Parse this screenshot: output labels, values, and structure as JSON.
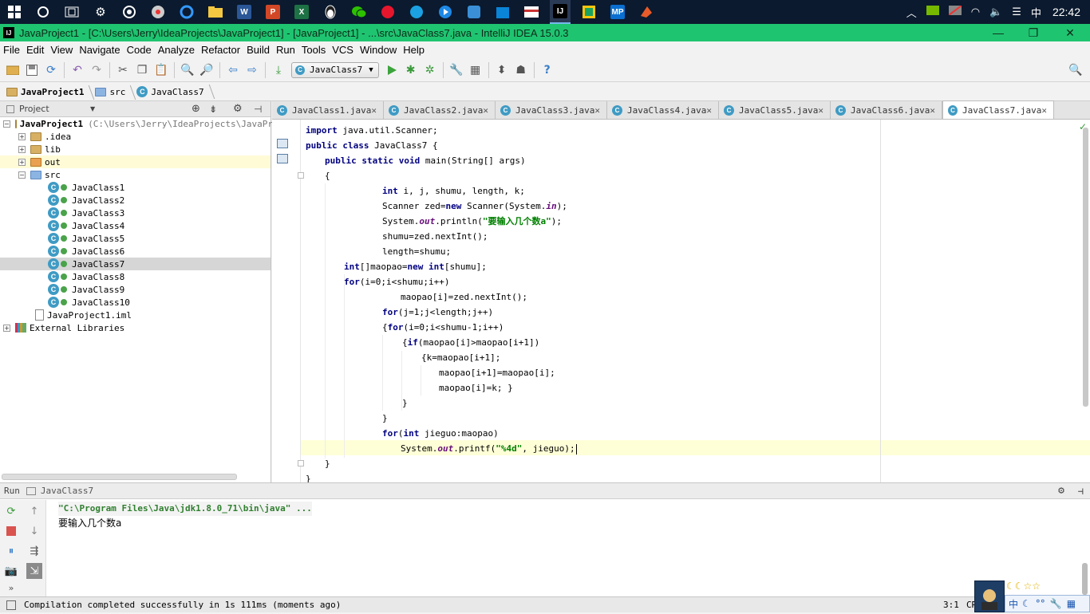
{
  "taskbar": {
    "apps": [
      "word-app",
      "ppt-app",
      "excel-app",
      "intellij-app",
      "mp-app"
    ],
    "word_label": "W",
    "ppt_label": "P",
    "excel_label": "X",
    "intellij_label": "IJ",
    "mp_label": "MP",
    "ime_lang": "中",
    "clock": "22:42"
  },
  "window": {
    "title": "JavaProject1 - [C:\\Users\\Jerry\\IdeaProjects\\JavaProject1] - [JavaProject1] - ...\\src\\JavaClass7.java - IntelliJ IDEA 15.0.3",
    "icon_label": "IJ"
  },
  "menu": [
    "File",
    "Edit",
    "View",
    "Navigate",
    "Code",
    "Analyze",
    "Refactor",
    "Build",
    "Run",
    "Tools",
    "VCS",
    "Window",
    "Help"
  ],
  "toolbar": {
    "run_config": "JavaClass7"
  },
  "breadcrumb": {
    "project": "JavaProject1",
    "src": "src",
    "file": "JavaClass7"
  },
  "project_panel": {
    "title": "Project",
    "root_label": "JavaProject1",
    "root_path": "(C:\\Users\\Jerry\\IdeaProjects\\JavaPr",
    "items": {
      "idea": ".idea",
      "lib": "lib",
      "out": "out",
      "src": "src",
      "iml": "JavaProject1.iml",
      "libs": "External Libraries"
    },
    "classes": [
      "JavaClass1",
      "JavaClass2",
      "JavaClass3",
      "JavaClass4",
      "JavaClass5",
      "JavaClass6",
      "JavaClass7",
      "JavaClass8",
      "JavaClass9",
      "JavaClass10"
    ],
    "selected": "JavaClass7"
  },
  "tabs": [
    "JavaClass1.java",
    "JavaClass2.java",
    "JavaClass3.java",
    "JavaClass4.java",
    "JavaClass5.java",
    "JavaClass6.java",
    "JavaClass7.java"
  ],
  "active_tab": "JavaClass7.java",
  "code": {
    "l1_kw": "import",
    "l1_rest": " java.util.Scanner;",
    "l2_kw": "public class",
    "l2_rest": " JavaClass7 {",
    "l3_kw": "public static void",
    "l3_rest": " main(String[] args)",
    "l4": "{",
    "l5_kw": "int",
    "l5_rest": " i, j, shumu, length, k;",
    "l6_a": "Scanner zed=",
    "l6_kw": "new",
    "l6_b": " Scanner(System.",
    "l6_fld": "in",
    "l6_c": ");",
    "l7_a": "System.",
    "l7_fld": "out",
    "l7_b": ".println(",
    "l7_str": "\"要输入几个数a\"",
    "l7_c": ");",
    "l8": "shumu=zed.nextInt();",
    "l9": "length=shumu;",
    "l10_kw": "int",
    "l10_a": "[]maopao=",
    "l10_kw2": "new",
    "l10_kw3": " int",
    "l10_b": "[shumu];",
    "l11_kw": "for",
    "l11_rest": "(i=0;i<shumu;i++)",
    "l12": "maopao[i]=zed.nextInt();",
    "l13_kw": "for",
    "l13_rest": "(j=1;j<length;j++)",
    "l14_a": "{",
    "l14_kw": "for",
    "l14_rest": "(i=0;i<shumu-1;i++)",
    "l15_a": "{",
    "l15_kw": "if",
    "l15_rest": "(maopao[i]>maopao[i+1])",
    "l16": "{k=maopao[i+1];",
    "l17": "maopao[i+1]=maopao[i];",
    "l18": "maopao[i]=k; }",
    "l19": "}",
    "l20": "}",
    "l21_kw": "for",
    "l21_a": "(",
    "l21_kw2": "int",
    "l21_rest": " jieguo:maopao)",
    "l22_a": "System.",
    "l22_fld": "out",
    "l22_b": ".printf(",
    "l22_str": "\"%4d\"",
    "l22_c": ", jieguo);",
    "l23": "}",
    "l24": "}"
  },
  "run_panel": {
    "label": "Run",
    "config": "JavaClass7",
    "cmd": "\"C:\\Program Files\\Java\\jdk1.8.0_71\\bin\\java\" ...",
    "output": "要输入几个数a"
  },
  "status": {
    "message": "Compilation completed successfully in 1s 111ms (moments ago)",
    "position": "3:1",
    "encoding": "CR"
  },
  "ime": {
    "lang": "中",
    "stars": "☾☾☆☆"
  },
  "colors": {
    "title_green": "#1fc471",
    "keyword": "#000080",
    "string": "#008000",
    "field": "#660e7a"
  }
}
